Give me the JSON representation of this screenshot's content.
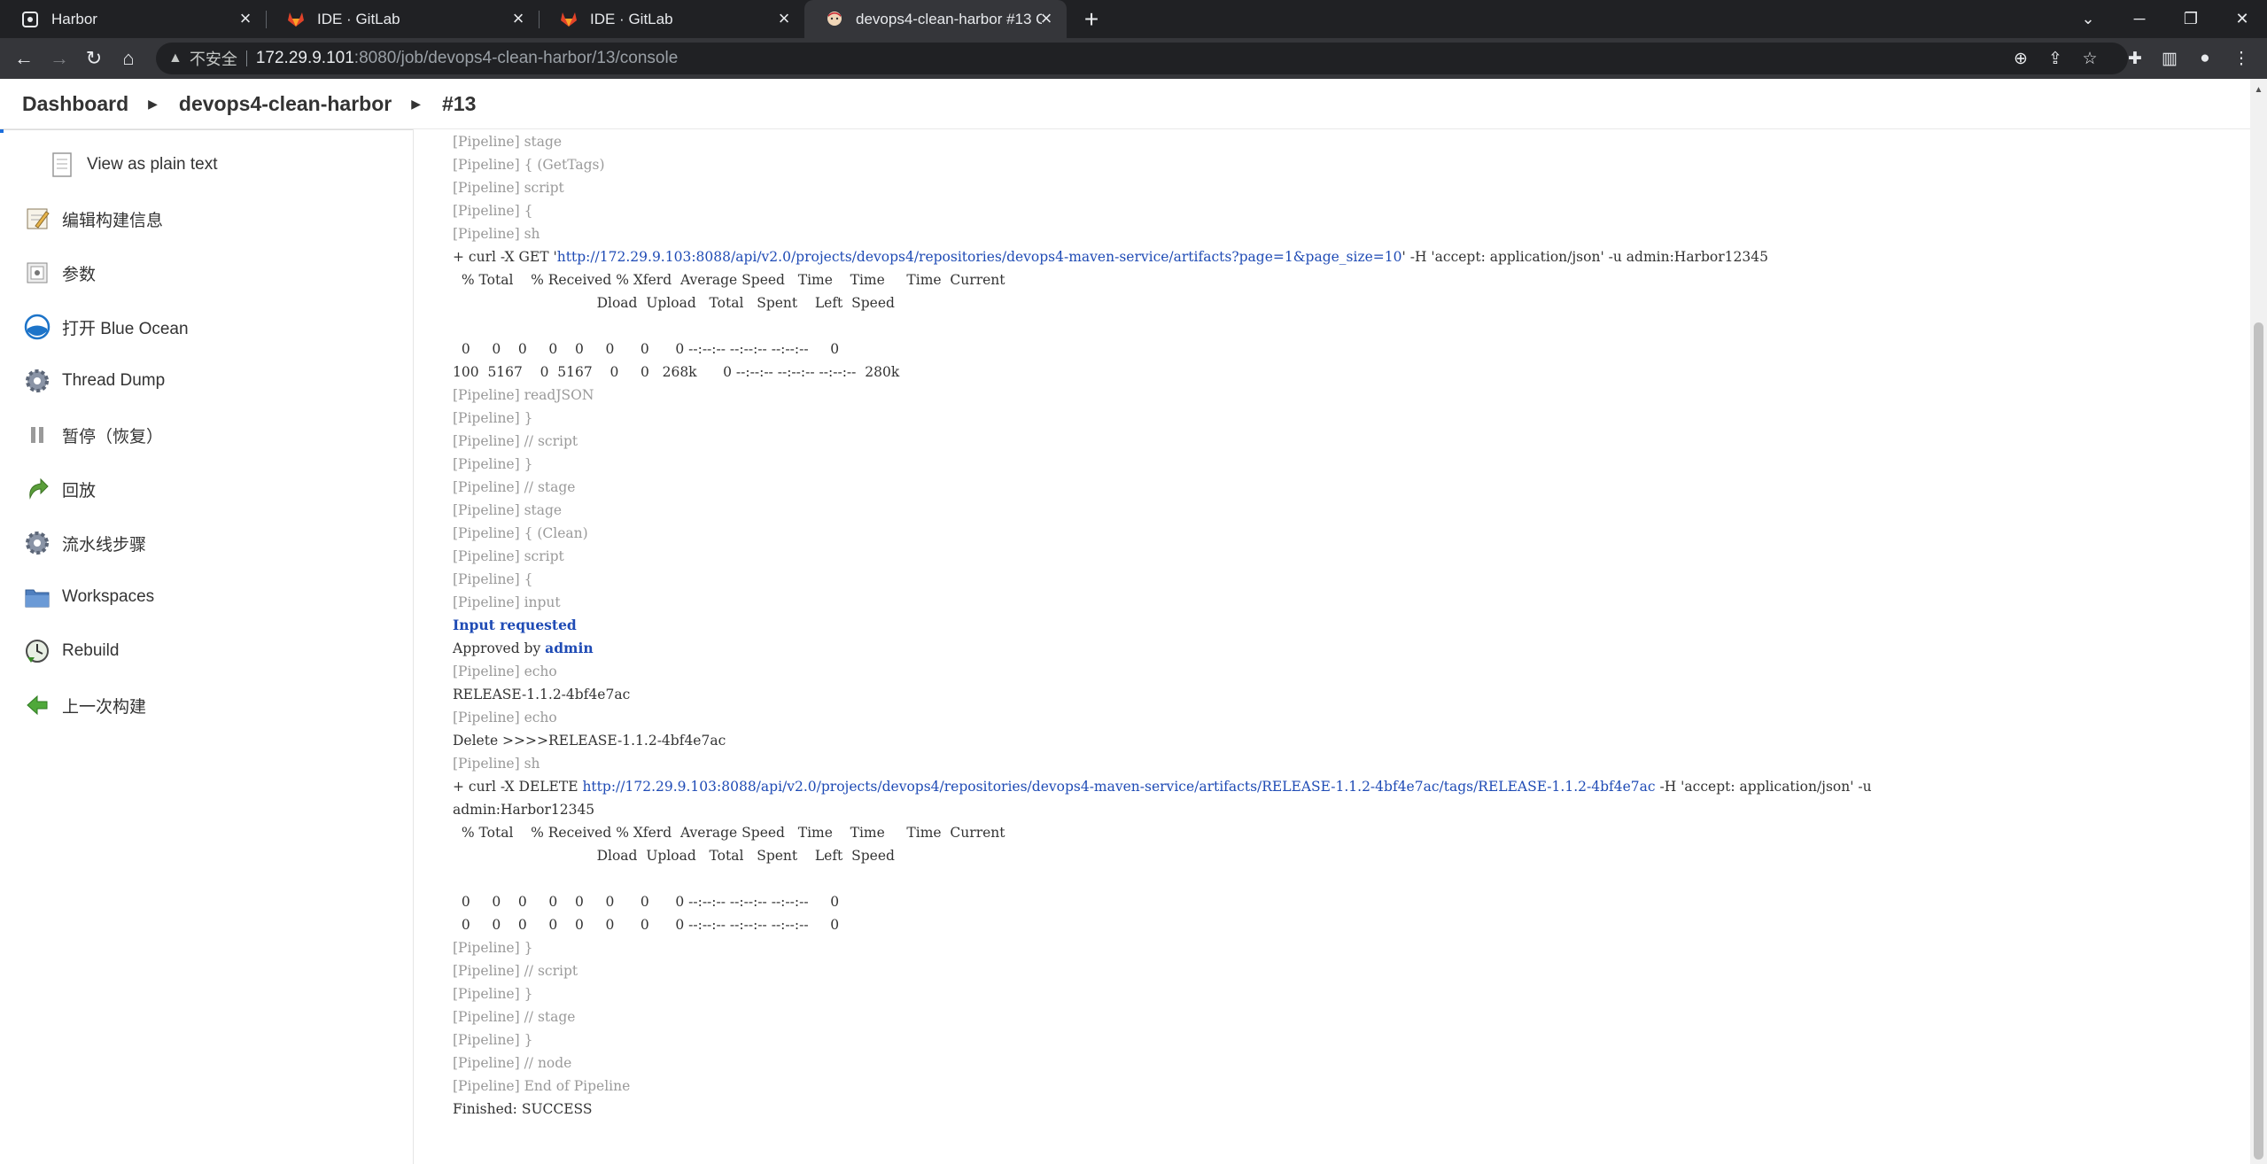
{
  "browser": {
    "tabs": [
      {
        "title": "Harbor",
        "icon": "harbor-icon"
      },
      {
        "title": "IDE · GitLab",
        "icon": "gitlab-icon"
      },
      {
        "title": "IDE · GitLab",
        "icon": "gitlab-icon"
      },
      {
        "title": "devops4-clean-harbor #13 Co",
        "icon": "jenkins-icon"
      }
    ],
    "insecure_label": "不安全",
    "url_host": "172.29.9.101",
    "url_path": ":8080/job/devops4-clean-harbor/13/console"
  },
  "breadcrumb": {
    "dashboard": "Dashboard",
    "job": "devops4-clean-harbor",
    "build": "#13"
  },
  "sidebar": {
    "items": [
      {
        "label": "View as plain text",
        "icon": "document-icon"
      },
      {
        "label": "编辑构建信息",
        "icon": "notepad-icon"
      },
      {
        "label": "参数",
        "icon": "parameters-icon"
      },
      {
        "label": "打开 Blue Ocean",
        "icon": "blue-ocean-icon"
      },
      {
        "label": "Thread Dump",
        "icon": "gear-icon"
      },
      {
        "label": "暂停（恢复）",
        "icon": "pause-icon"
      },
      {
        "label": "回放",
        "icon": "replay-icon"
      },
      {
        "label": "流水线步骤",
        "icon": "gear-icon"
      },
      {
        "label": "Workspaces",
        "icon": "folder-icon"
      },
      {
        "label": "Rebuild",
        "icon": "rebuild-icon"
      },
      {
        "label": "上一次构建",
        "icon": "previous-arrow-icon"
      }
    ]
  },
  "console": {
    "l01": "[Pipeline] stage",
    "l02": "[Pipeline] { (GetTags)",
    "l03": "[Pipeline] script",
    "l04": "[Pipeline] {",
    "l05": "[Pipeline] sh",
    "l06_pre": "+ curl -X GET '",
    "l06_url": "http://172.29.9.103:8088/api/v2.0/projects/devops4/repositories/devops4-maven-service/artifacts?page=1&page_size=10",
    "l06_post": "' -H 'accept: application/json' -u admin:Harbor12345",
    "l07": "  % Total    % Received % Xferd  Average Speed   Time    Time     Time  Current",
    "l08": "                                 Dload  Upload   Total   Spent    Left  Speed",
    "l09": "",
    "l10": "  0     0    0     0    0     0      0      0 --:--:-- --:--:-- --:--:--     0",
    "l11": "100  5167    0  5167    0     0   268k      0 --:--:-- --:--:-- --:--:--  280k",
    "l12": "[Pipeline] readJSON",
    "l13": "[Pipeline] }",
    "l14": "[Pipeline] // script",
    "l15": "[Pipeline] }",
    "l16": "[Pipeline] // stage",
    "l17": "[Pipeline] stage",
    "l18": "[Pipeline] { (Clean)",
    "l19": "[Pipeline] script",
    "l20": "[Pipeline] {",
    "l21": "[Pipeline] input",
    "l22": "Input requested",
    "l23_pre": "Approved by ",
    "l23_user": "admin",
    "l24": "[Pipeline] echo",
    "l25": "RELEASE-1.1.2-4bf4e7ac",
    "l26": "[Pipeline] echo",
    "l27": "Delete >>>>RELEASE-1.1.2-4bf4e7ac",
    "l28": "[Pipeline] sh",
    "l29_pre": "+ curl -X DELETE ",
    "l29_url": "http://172.29.9.103:8088/api/v2.0/projects/devops4/repositories/devops4-maven-service/artifacts/RELEASE-1.1.2-4bf4e7ac/tags/RELEASE-1.1.2-4bf4e7ac",
    "l29_post": " -H 'accept: application/json' -u",
    "l30": "admin:Harbor12345",
    "l31": "  % Total    % Received % Xferd  Average Speed   Time    Time     Time  Current",
    "l32": "                                 Dload  Upload   Total   Spent    Left  Speed",
    "l33": "",
    "l34": "  0     0    0     0    0     0      0      0 --:--:-- --:--:-- --:--:--     0",
    "l35": "  0     0    0     0    0     0      0      0 --:--:-- --:--:-- --:--:--     0",
    "l36": "[Pipeline] }",
    "l37": "[Pipeline] // script",
    "l38": "[Pipeline] }",
    "l39": "[Pipeline] // stage",
    "l40": "[Pipeline] }",
    "l41": "[Pipeline] // node",
    "l42": "[Pipeline] End of Pipeline",
    "l43": "Finished: SUCCESS"
  },
  "colors": {
    "chrome_dark": "#202124",
    "chrome_bar": "#35363a",
    "link_blue": "#1f4bb5",
    "pipeline_gray": "#9a9a9a"
  }
}
